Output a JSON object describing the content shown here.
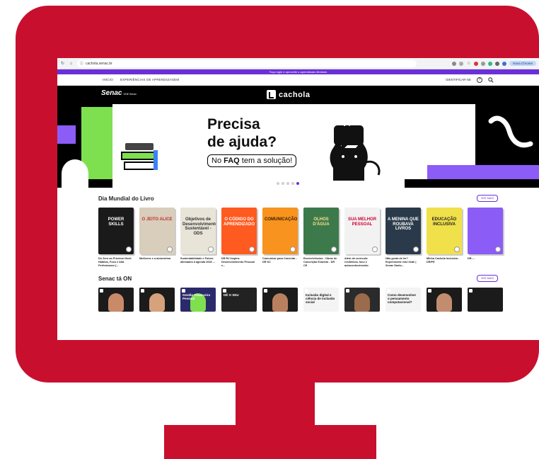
{
  "browser": {
    "url": "cachola.senac.br",
    "profile_label": "Nova Chrome"
  },
  "banner": {
    "text": "Faça login e aproveite o aprendizado ilimitado"
  },
  "nav": {
    "links": [
      "INÍCIO",
      "EXPERIÊNCIAS DE APRENDIZAGEM"
    ],
    "identify_label": "IDENTIFICAR-SE",
    "help_label": "?"
  },
  "brand": {
    "senac_label": "Senac",
    "senac_sub": "ONE Senac",
    "cachola_label": "cachola"
  },
  "hero": {
    "headline_line1": "Precisa",
    "headline_line2": "de ajuda?",
    "faq_prefix": "No ",
    "faq_bold": "FAQ",
    "faq_suffix": " tem a solução!",
    "speech": "?",
    "speech_small": "?",
    "slides_count": 5,
    "active_slide": 5
  },
  "section_books": {
    "title": "Dia Mundial do Livro",
    "see_more": "VER MAIS",
    "items": [
      {
        "title": "Do Zero ao Próximo Nível: Hábitos, Foco e Alta Performance [...",
        "cover_text": "POWER SKILLS",
        "bg": "#1a1a1a",
        "fg": "#ffffff"
      },
      {
        "title": "Mulheres e a autoestima",
        "cover_text": "O JEITO ALICE",
        "bg": "#d9cdbb",
        "fg": "#b33"
      },
      {
        "title": "Sustentabilidade e Futuro alinhados à agenda 2030 ...",
        "cover_text": "Objetivos de Desenvolvimento Sustentável - ODS",
        "bg": "#e8e4d8",
        "fg": "#333"
      },
      {
        "title": "DR RJ Inspira: Desenvolvimento Pessoal e...",
        "cover_text": "O CÓDIGO DO APRENDIZADO",
        "bg": "#ff5a1f",
        "fg": "#ffffff"
      },
      {
        "title": "Comunicar para Conectar - DR SC",
        "cover_text": "COMUNICAÇÃO",
        "bg": "#f7931e",
        "fg": "#3a1a00"
      },
      {
        "title": "Escrevivências : Obras de Conceição Evaristo - DR CE",
        "cover_text": "OLHOS D'ÁGUA",
        "bg": "#3c7a4b",
        "fg": "#ffe08a"
      },
      {
        "title": "Além do currículo: resiliência, foco e autoconhecimento",
        "cover_text": "SUA MELHOR PESSOAL",
        "bg": "#f2f2f2",
        "fg": "#c03"
      },
      {
        "title": "Não gosta de ler? Experimente este lista! | Senac Santo...",
        "cover_text": "A MENINA QUE ROUBAVA LIVROS",
        "bg": "#2a3a4a",
        "fg": "#ffffff"
      },
      {
        "title": "Minha Cachola Inclusiva - DR/PE",
        "cover_text": "EDUCAÇÃO INCLUSIVA",
        "bg": "#f0e04a",
        "fg": "#222"
      },
      {
        "title": "DR-...",
        "cover_text": "",
        "bg": "#8b5cf6",
        "fg": "#ffffff"
      }
    ]
  },
  "section_videos": {
    "title": "Senac tá ON",
    "see_more": "VER MAIS",
    "items": [
      {
        "text": "",
        "bg": "#1b1b1b",
        "face": "#c98a6a"
      },
      {
        "text": "",
        "bg": "#1b1b1b",
        "face": "#d6a27c"
      },
      {
        "text": "Gestão Financeira Pessoal",
        "bg": "#2a2a6a",
        "face": "#7ee04f"
      },
      {
        "text": "DÊ O SEU",
        "bg": "#222222",
        "face": ""
      },
      {
        "text": "",
        "bg": "#1b1b1b",
        "face": "#b98060"
      },
      {
        "text": "Inclusão digital e ciência de inclusão social",
        "bg": "#f4f4f4",
        "face": ""
      },
      {
        "text": "",
        "bg": "#2b2b2b",
        "face": "#9a6b4c"
      },
      {
        "text": "Como desenvolver o pensamento computacional?",
        "bg": "#f4f4f4",
        "face": ""
      },
      {
        "text": "",
        "bg": "#1b1b1b",
        "face": "#c28d6e"
      },
      {
        "text": "",
        "bg": "#1b1b1b",
        "face": ""
      }
    ]
  }
}
